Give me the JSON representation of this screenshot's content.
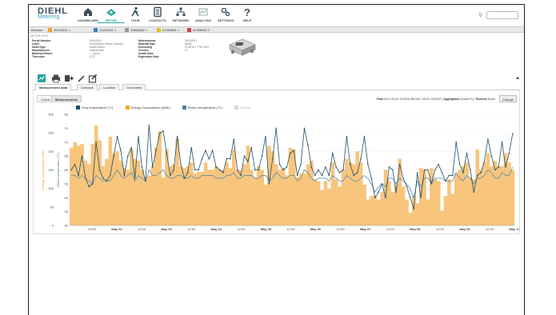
{
  "header": {
    "logo_line1": "DIEHL",
    "logo_line2": "Metering",
    "nav": [
      {
        "label": "DASHBOARD",
        "icon": "home-icon"
      },
      {
        "label": "METER",
        "icon": "meter-icon",
        "active": true
      },
      {
        "label": "TOUR",
        "icon": "walk-icon"
      },
      {
        "label": "CONTACTS",
        "icon": "contacts-icon"
      },
      {
        "label": "NETWORK",
        "icon": "network-icon"
      },
      {
        "label": "ANALYSIS",
        "icon": "analysis-icon"
      },
      {
        "label": "SETTINGS",
        "icon": "settings-icon"
      },
      {
        "label": "HELP",
        "icon": "help-icon"
      }
    ],
    "search_icon": "search-icon"
  },
  "tabbar": {
    "browse": "Browser",
    "tabs": [
      {
        "label": "39116511",
        "color": "#f0a030"
      },
      {
        "label": "11053916",
        "color": "#3a7fc0"
      },
      {
        "label": "15665482",
        "color": "#999999"
      },
      {
        "label": "61054561",
        "color": "#f0c020"
      },
      {
        "label": "67056451",
        "color": "#d04040"
      }
    ]
  },
  "meter_info": {
    "heading": "METER DATA",
    "col1_labels": [
      "Serial Number",
      "Label",
      "MeterType",
      "Manufacturer",
      "BatteryLifetime",
      "Timezone"
    ],
    "col1_values": [
      "39116511",
      "Fernwärme Kleine Dieburg",
      "Radio Meter",
      "Hydrometer",
      "— years",
      "UTC"
    ],
    "col2_labels": [
      "Metemumber",
      "MeterallType",
      "Dismodeg",
      "Version",
      "Install Date",
      "Expiration Date"
    ],
    "col2_values": [
      "39116511",
      "Meter",
      "SHARKY 775 LoRT",
      "27",
      "",
      ""
    ]
  },
  "subtabs": [
    "Measurement data",
    "Contacts",
    "Location",
    "Comments"
  ],
  "chart_tabs": [
    "Charts",
    "Measurements"
  ],
  "range": {
    "from_label": "From",
    "from": "2017-04-22 12:00:00",
    "to_label": "To",
    "to": "2017-05-20 12:00:00",
    "agg_label": "Aggregation",
    "agg": "Closed To",
    "tz_label": "Timeunit",
    "tz": "Hours"
  },
  "change_label": "Change",
  "legend": [
    {
      "name": "Flow temperature (°C)",
      "color": "#1f4e6b"
    },
    {
      "name": "Energy Consumption (kWh)",
      "color": "#f5a623"
    },
    {
      "name": "Return temperature (°C)",
      "color": "#4a7fa0"
    },
    {
      "name": "Volume",
      "color": "#ffffff"
    }
  ],
  "chart_data": {
    "type": "bar+line",
    "x_ticks": [
      "12:00",
      "May 02",
      "12:00",
      "May 03",
      "12:00",
      "May 04",
      "12:00",
      "May 05",
      "12:00",
      "May 06",
      "12:00",
      "May 07",
      "12:00",
      "May 08",
      "12:00",
      "May 09",
      "12:00",
      "May 10"
    ],
    "y_left_label": "Energy Consumption (kWh)",
    "y_left_ticks": [
      300,
      250,
      200,
      150,
      100,
      50,
      0
    ],
    "y_left_range": [
      0,
      300
    ],
    "y_right_label": "Return temperature (°C)",
    "y_right_ticks": [
      80,
      75,
      70,
      65,
      60,
      55,
      50,
      45,
      40
    ],
    "y_right_range": [
      40,
      80
    ],
    "series": [
      {
        "name": "Energy Consumption (kWh)",
        "type": "bar",
        "values": [
          210,
          225,
          215,
          220,
          175,
          165,
          220,
          270,
          230,
          160,
          180,
          240,
          195,
          200,
          175,
          155,
          150,
          205,
          180,
          175,
          150,
          130,
          135,
          160,
          210,
          255,
          130,
          205,
          160,
          165,
          235,
          160,
          155,
          160,
          170,
          140,
          145,
          145,
          170,
          150,
          150,
          160,
          150,
          150,
          170,
          155,
          205,
          150,
          150,
          165,
          215,
          150,
          130,
          160,
          150,
          110,
          215,
          200,
          165,
          150,
          155,
          135,
          210,
          205,
          130,
          140,
          140,
          165,
          175,
          125,
          120,
          95,
          120,
          100,
          170,
          125,
          105,
          150,
          180,
          170,
          165,
          200,
          170,
          110,
          70,
          80,
          80,
          70,
          90,
          150,
          120,
          90,
          110,
          180,
          105,
          70,
          35,
          80,
          60,
          155,
          150,
          70,
          155,
          125,
          120,
          40,
          80,
          125,
          85,
          140,
          150,
          160,
          170,
          130,
          125,
          205,
          150,
          170,
          195,
          160,
          175,
          160,
          160,
          195,
          170,
          150
        ]
      },
      {
        "name": "Flow temperature (°C)",
        "type": "line",
        "values": [
          60,
          62,
          58,
          65,
          57,
          54,
          55,
          70,
          60,
          57,
          56,
          58,
          65,
          72,
          67,
          58,
          65,
          68,
          57,
          72,
          61,
          56,
          76,
          61,
          67,
          73,
          74,
          66,
          58,
          60,
          72,
          62,
          57,
          59,
          68,
          60,
          60,
          64,
          67,
          64,
          67,
          61,
          60,
          59,
          64,
          64,
          71,
          60,
          58,
          65,
          63,
          68,
          60,
          60,
          65,
          72,
          55,
          64,
          75,
          62,
          60,
          61,
          66,
          67,
          58,
          62,
          75,
          69,
          61,
          58,
          60,
          58,
          61,
          58,
          66,
          61,
          59,
          60,
          72,
          62,
          58,
          59,
          64,
          72,
          62,
          57,
          50,
          52,
          55,
          50,
          61,
          60,
          52,
          62,
          57,
          54,
          50,
          46,
          59,
          50,
          60,
          60,
          55,
          60,
          62,
          59,
          56,
          58,
          58,
          70,
          62,
          59,
          66,
          60,
          52,
          58,
          59,
          63,
          71,
          65,
          60,
          61,
          70,
          61,
          66,
          73
        ]
      },
      {
        "name": "Return temperature (°C)",
        "type": "line",
        "values": [
          58,
          58,
          57,
          58,
          57,
          56,
          55,
          58,
          57,
          56,
          56,
          56,
          58,
          60,
          58,
          57,
          58,
          59,
          56,
          58,
          57,
          56,
          60,
          58,
          58,
          59,
          60,
          58,
          57,
          57,
          58,
          58,
          57,
          57,
          58,
          57,
          57,
          58,
          58,
          58,
          58,
          57,
          57,
          57,
          58,
          58,
          59,
          57,
          57,
          58,
          58,
          58,
          57,
          57,
          58,
          58,
          56,
          57,
          59,
          58,
          57,
          57,
          58,
          58,
          56,
          57,
          60,
          59,
          57,
          56,
          57,
          57,
          57,
          56,
          58,
          57,
          56,
          56,
          58,
          57,
          56,
          56,
          57,
          58,
          57,
          55,
          52,
          54,
          55,
          54,
          57,
          57,
          55,
          57,
          56,
          55,
          53,
          50,
          56,
          54,
          57,
          57,
          55,
          57,
          57,
          57,
          56,
          56,
          56,
          59,
          57,
          56,
          58,
          57,
          55,
          57,
          57,
          58,
          60,
          59,
          57,
          57,
          59,
          58,
          58,
          61
        ]
      }
    ]
  }
}
